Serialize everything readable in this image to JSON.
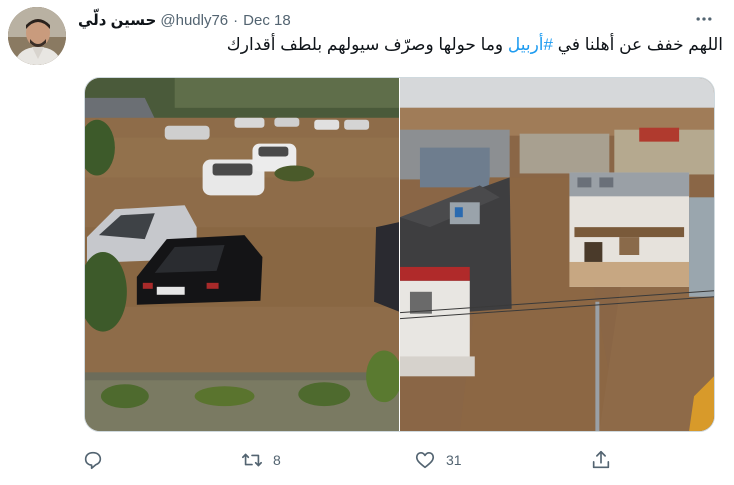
{
  "user": {
    "display_name": "حسين دلّي",
    "handle": "@hudly76",
    "date": "Dec 18"
  },
  "tweet": {
    "text_part1": "اللهم خفف عن أهلنا في ",
    "hashtag": "#أربيل",
    "text_part2": " وما حولها وصرّف سيولهم بلطف أقدارك"
  },
  "actions": {
    "reply_count": "",
    "retweet_count": "8",
    "like_count": "31"
  },
  "icons": {
    "more": "more-dots-icon",
    "reply": "reply-icon",
    "retweet": "retweet-icon",
    "like": "heart-icon",
    "share": "share-icon"
  },
  "colors": {
    "text": "#0f1419",
    "secondary": "#536471",
    "accent": "#1d9bf0",
    "border": "#cfd9de"
  }
}
